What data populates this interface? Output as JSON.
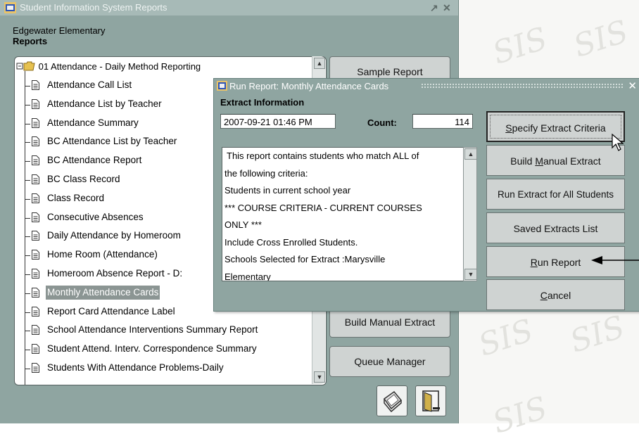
{
  "window": {
    "title": "Student Information System Reports",
    "controls": [
      "↗",
      "✕"
    ],
    "school": "Edgewater Elementary",
    "section": "Reports"
  },
  "tree": {
    "root": "01 Attendance - Daily Method Reporting",
    "items": [
      "Attendance Call List",
      "Attendance List by Teacher",
      "Attendance Summary",
      "BC Attendance List by Teacher",
      "BC Attendance Report",
      "BC Class Record",
      "Class Record",
      "Consecutive Absences",
      "Daily Attendance by Homeroom",
      "Home Room (Attendance)",
      "Homeroom Absence Report - D:",
      "Monthly Attendance Cards",
      "Report Card Attendance Label",
      "School Attendance Interventions Summary Report",
      "Student Attend. Interv. Correspondence Summary",
      "Students With Attendance Problems-Daily"
    ],
    "selected": "Monthly Attendance Cards"
  },
  "side_buttons": {
    "sample_report": "Sample Report",
    "build_manual_extract": "Build Manual Extract",
    "queue_manager": "Queue Manager"
  },
  "dialog": {
    "title": "Run Report: Monthly Attendance Cards",
    "section_label": "Extract Information",
    "datetime": "2007-09-21 01:46 PM",
    "count_label": "Count:",
    "count_value": "114",
    "description_lines": [
      "This report contains students who match ALL of",
      "the following criteria:",
      "Students in current school year",
      "*** COURSE CRITERIA - CURRENT COURSES",
      "ONLY ***",
      "Include Cross Enrolled Students.",
      "Schools Selected for Extract :Marysville",
      "Elementary"
    ],
    "buttons": {
      "specify": {
        "pre": "",
        "key": "S",
        "post": "pecify Extract Criteria"
      },
      "build": {
        "pre": "Build ",
        "key": "M",
        "post": "anual Extract"
      },
      "run_all": {
        "pre": "Run Extract for All Students",
        "key": "",
        "post": ""
      },
      "saved": {
        "pre": "Saved Extracts List",
        "key": "",
        "post": ""
      },
      "run": {
        "pre": "",
        "key": "R",
        "post": "un Report"
      },
      "cancel": {
        "pre": "",
        "key": "C",
        "post": "ancel"
      }
    }
  },
  "colors": {
    "window_bg": "#8fa5a1",
    "selected_item": "#8b9593"
  }
}
